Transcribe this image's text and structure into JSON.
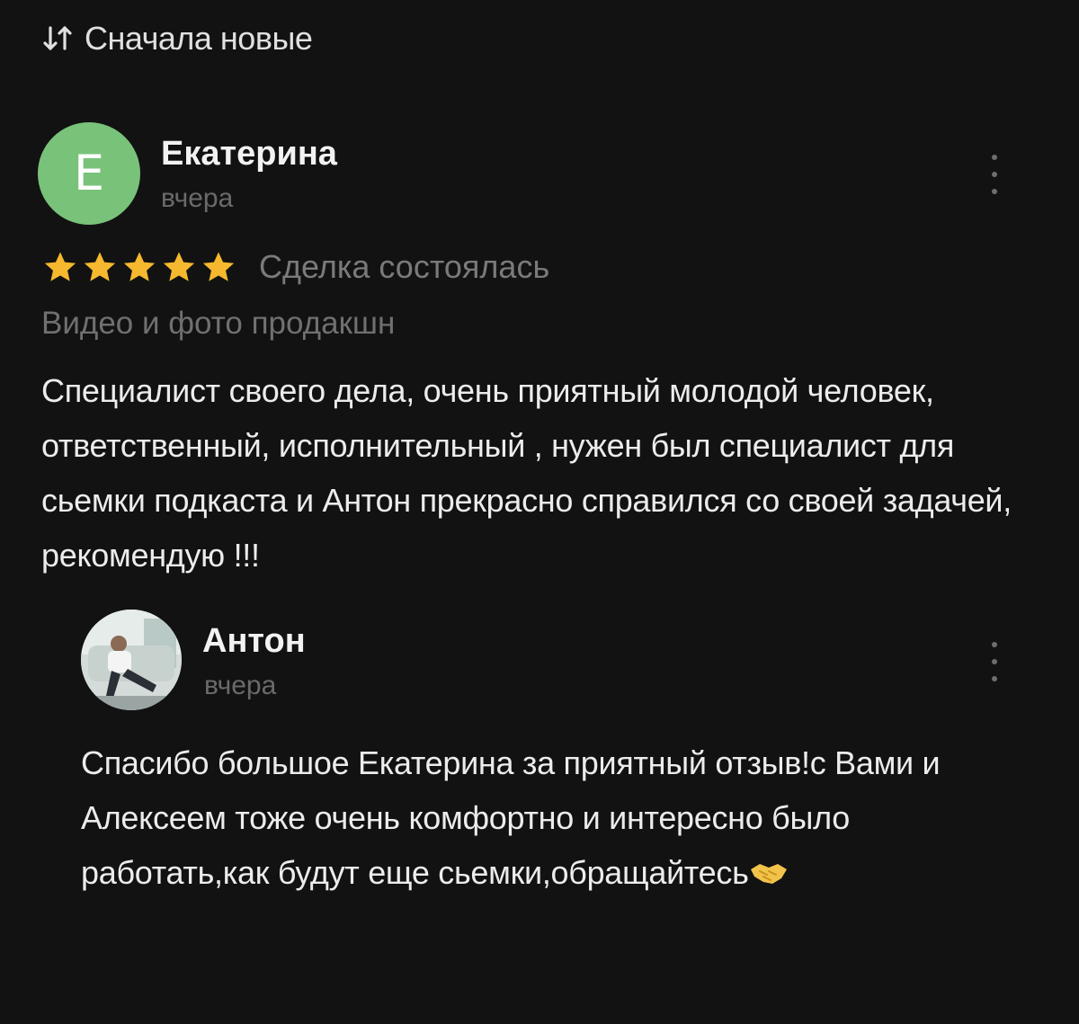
{
  "sort": {
    "icon": "sort-arrows-icon",
    "label": "Сначала новые"
  },
  "review": {
    "avatar_letter": "Е",
    "avatar_color": "#79c27a",
    "author": "Екатерина",
    "date": "вчера",
    "rating": 5,
    "rating_max": 5,
    "star_color": "#f5b82e",
    "deal_status": "Сделка состоялась",
    "category": "Видео и фото продакшн",
    "text": "Специалист своего дела, очень приятный молодой человек, ответственный, исполнительный , нужен был специалист для сьемки подкаста и Антон прекрасно справился со своей задачей, рекомендую !!!"
  },
  "reply": {
    "author": "Антон",
    "date": "вчера",
    "text": "Спасибо большое Екатерина за приятный отзыв!с Вами и Алексеем тоже очень комфортно и интересно было работать,как будут еще сьемки,обращайтесь",
    "emoji": "handshake-icon"
  }
}
